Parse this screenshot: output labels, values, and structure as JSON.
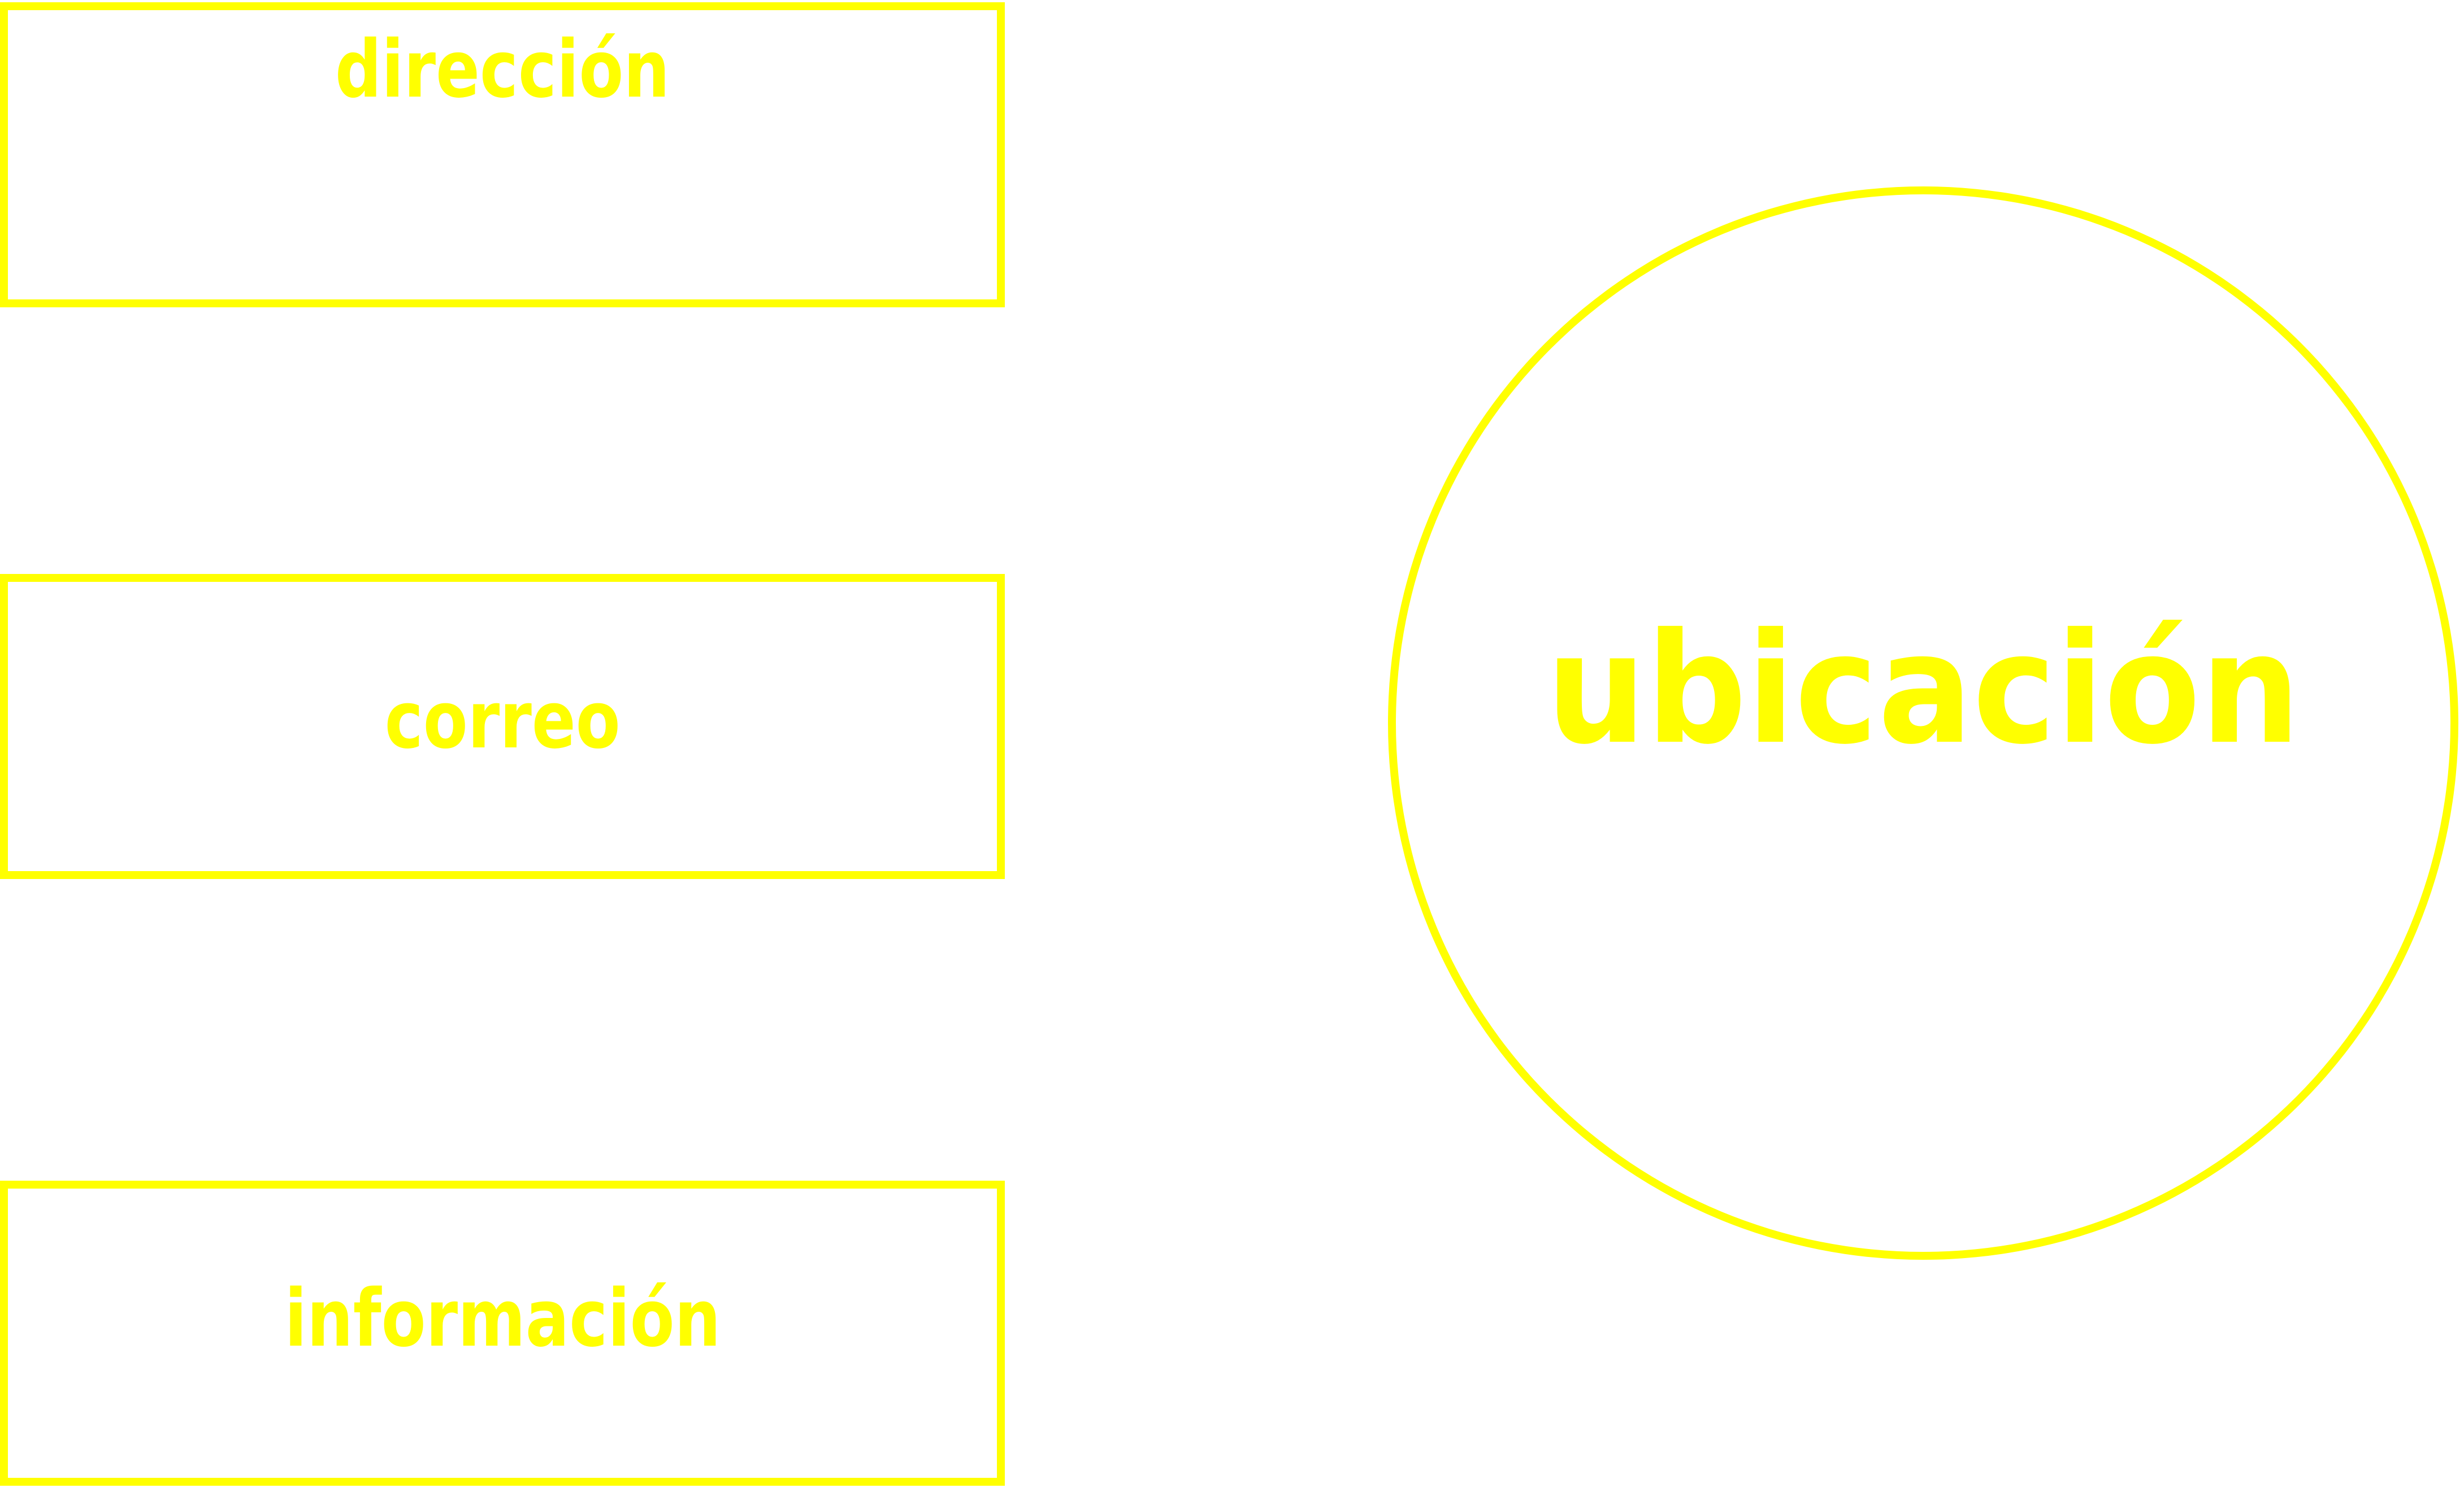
{
  "accent_color": "#ffff00",
  "boxes": [
    {
      "label": "dirección"
    },
    {
      "label": "correo"
    },
    {
      "label": "información"
    }
  ],
  "circle": {
    "label": "ubicación"
  }
}
